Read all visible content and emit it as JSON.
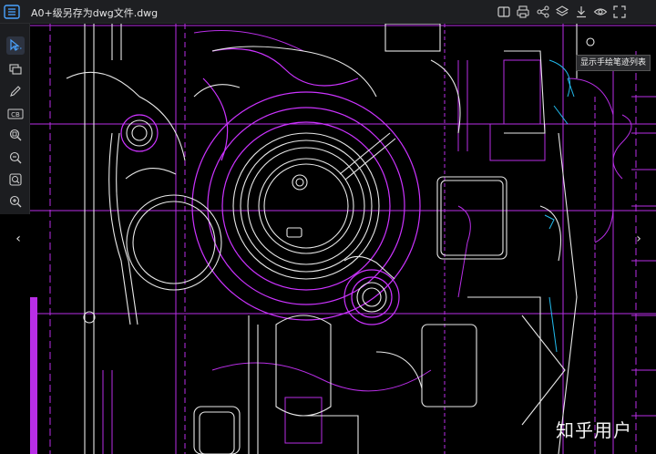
{
  "window": {
    "title": "A0+级另存为dwg文件.dwg",
    "menu_icon": "list-menu-icon"
  },
  "toolbar": {
    "icons": [
      "split-view-icon",
      "print-icon",
      "share-icon",
      "layers-icon",
      "download-icon",
      "eye-icon",
      "fullscreen-icon"
    ]
  },
  "sidebar": {
    "items": [
      {
        "icon": "select-cursor-icon",
        "active": true
      },
      {
        "icon": "layer-toggle-icon",
        "active": false
      },
      {
        "icon": "pencil-icon",
        "active": false
      },
      {
        "icon": "cad-text-icon",
        "label": "CB",
        "active": false
      },
      {
        "icon": "zoom-window-icon",
        "active": false
      },
      {
        "icon": "zoom-out-icon",
        "active": false
      },
      {
        "icon": "zoom-extents-icon",
        "active": false
      },
      {
        "icon": "zoom-in-icon",
        "active": false
      }
    ]
  },
  "navigation": {
    "prev_label": "‹",
    "next_label": "›"
  },
  "tooltip": {
    "text": "显示手绘笔迹列表"
  },
  "watermark": {
    "text": "知乎用户"
  },
  "colors": {
    "background": "#000000",
    "titlebar": "#1e1f22",
    "drawing_white": "#e8e8e8",
    "drawing_magenta": "#cc33ff",
    "drawing_cyan": "#22bbee"
  }
}
